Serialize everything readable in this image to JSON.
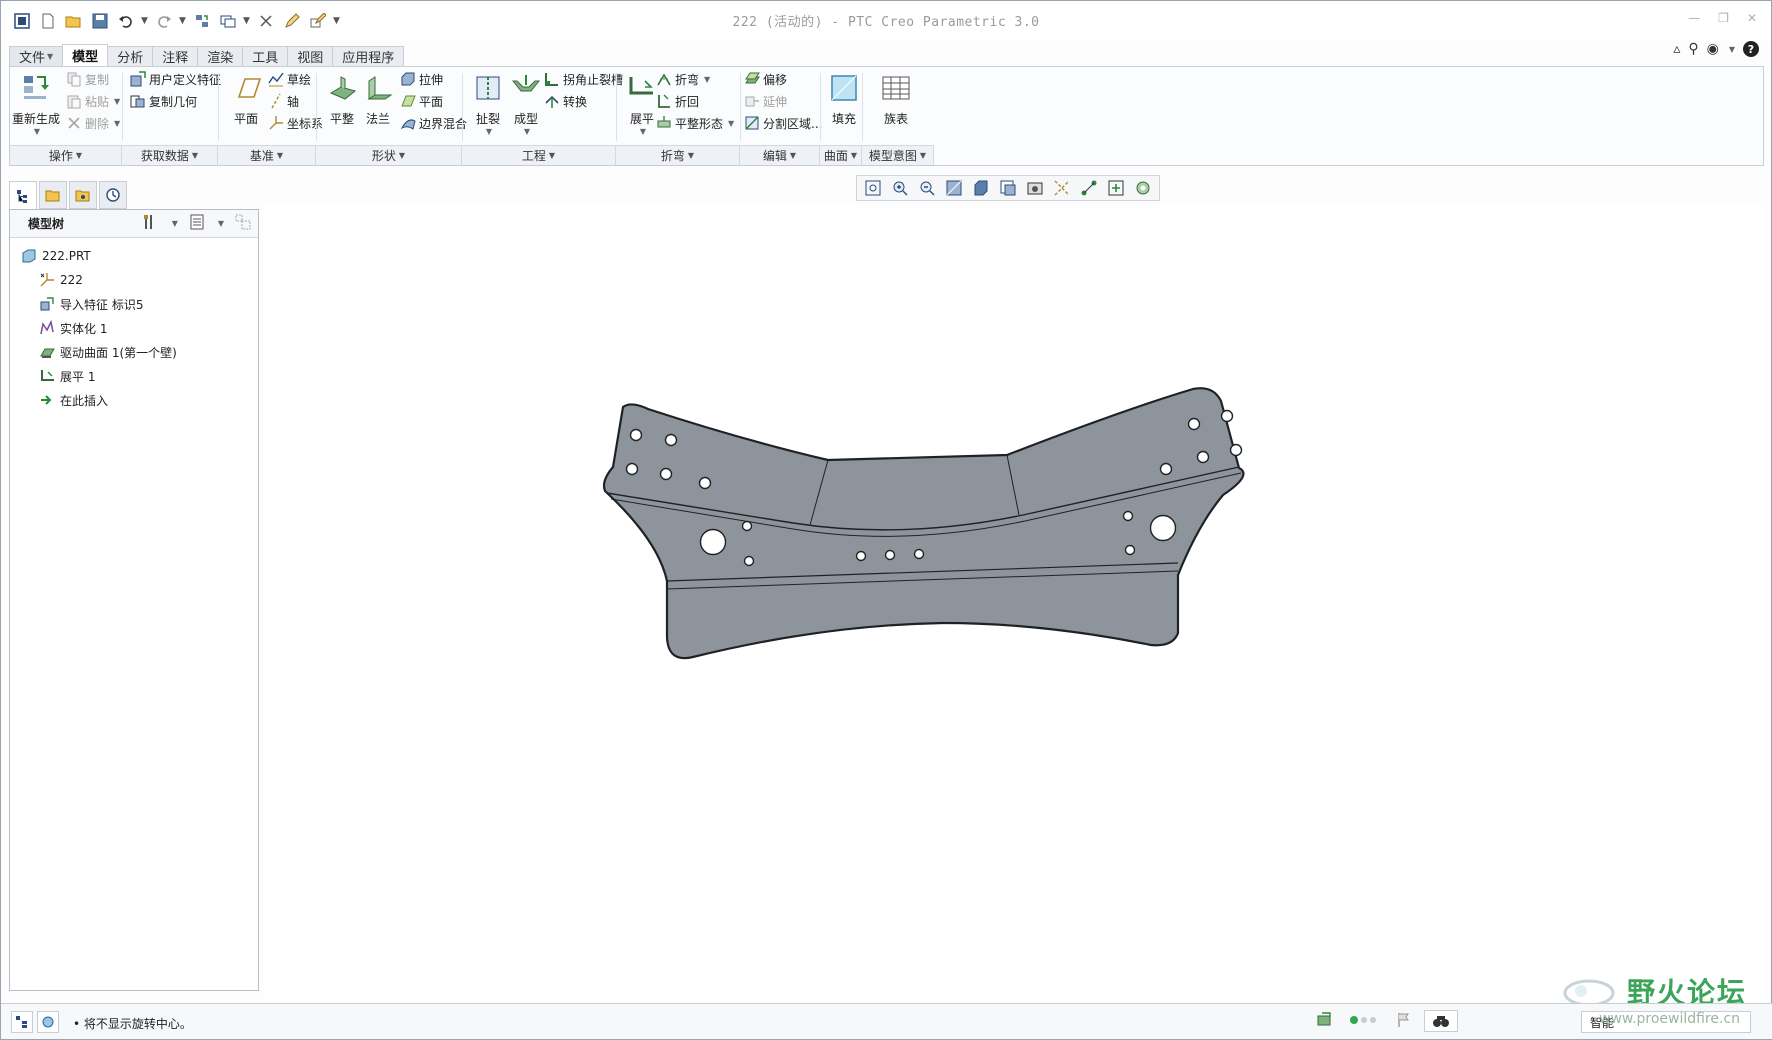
{
  "window": {
    "title": "222 (活动的) - PTC Creo Parametric 3.0"
  },
  "tabs": [
    "文件",
    "模型",
    "分析",
    "注释",
    "渲染",
    "工具",
    "视图",
    "应用程序"
  ],
  "active_tab": "模型",
  "ribbon": {
    "operations": {
      "label": "操作",
      "regenerate": "重新生成",
      "copy": "复制",
      "paste": "粘贴",
      "delete": "删除"
    },
    "get_data": {
      "label": "获取数据",
      "udf": "用户定义特征",
      "copy_geom": "复制几何"
    },
    "datum": {
      "label": "基准",
      "plane": "平面",
      "sketch": "草绘",
      "axis": "轴",
      "csys": "坐标系"
    },
    "shapes": {
      "label": "形状",
      "flat": "平整",
      "flange": "法兰",
      "extrude": "拉伸",
      "planar": "平面",
      "boundary_blend": "边界混合"
    },
    "engineering": {
      "label": "工程",
      "rip": "扯裂",
      "form": "成型",
      "corner_relief": "拐角止裂槽",
      "convert": "转换"
    },
    "bends": {
      "label": "折弯",
      "unbend": "展平",
      "bend": "折弯",
      "bend_back": "折回",
      "flat_state": "平整形态"
    },
    "editing": {
      "label": "编辑",
      "offset": "偏移",
      "extend": "延伸",
      "split_area": "分割区域..."
    },
    "surfaces": {
      "label": "曲面",
      "fill": "填充"
    },
    "model_intent": {
      "label": "模型意图",
      "family_table": "族表"
    }
  },
  "model_tree": {
    "title": "模型树",
    "items": [
      {
        "label": "222.PRT",
        "icon": "part-icon"
      },
      {
        "label": "222",
        "icon": "csys-icon"
      },
      {
        "label": "导入特征 标识5",
        "icon": "import-feature-icon"
      },
      {
        "label": "实体化 1",
        "icon": "solidify-icon"
      },
      {
        "label": "驱动曲面 1(第一个壁)",
        "icon": "driving-surface-icon"
      },
      {
        "label": "展平 1",
        "icon": "unbend-icon"
      },
      {
        "label": "在此插入",
        "icon": "insert-here-icon"
      }
    ]
  },
  "status": {
    "message": "• 将不显示旋转中心。",
    "filter": "智能"
  },
  "watermark": {
    "text": "野火论坛",
    "url": "www.proewildfire.cn"
  },
  "colors": {
    "part_fill": "#8e949b",
    "part_edge": "#1e2226",
    "accent": "#2e7bcf"
  }
}
